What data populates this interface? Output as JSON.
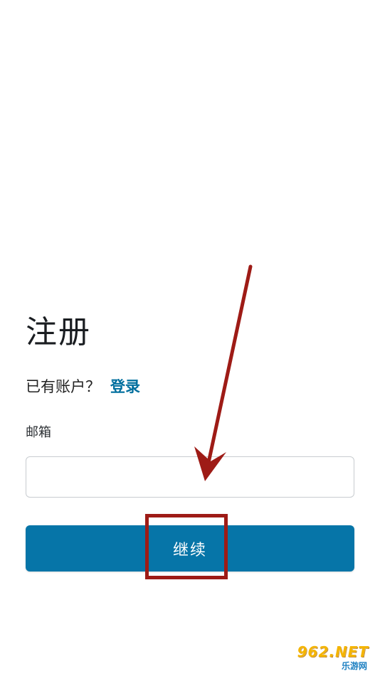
{
  "form": {
    "title": "注册",
    "account_question": "已有账户？",
    "login_link": "登录",
    "email_label": "邮箱",
    "email_value": "",
    "email_placeholder": "",
    "continue_label": "继续"
  },
  "annotation": {
    "arrow_color": "#9e1b16",
    "box_color": "#9e1b16"
  },
  "watermark": {
    "top_text": "962.NET",
    "bottom_text": "乐游网"
  },
  "colors": {
    "accent": "#0675a8",
    "link": "#006f9e",
    "input_border": "#c8ccd0"
  }
}
